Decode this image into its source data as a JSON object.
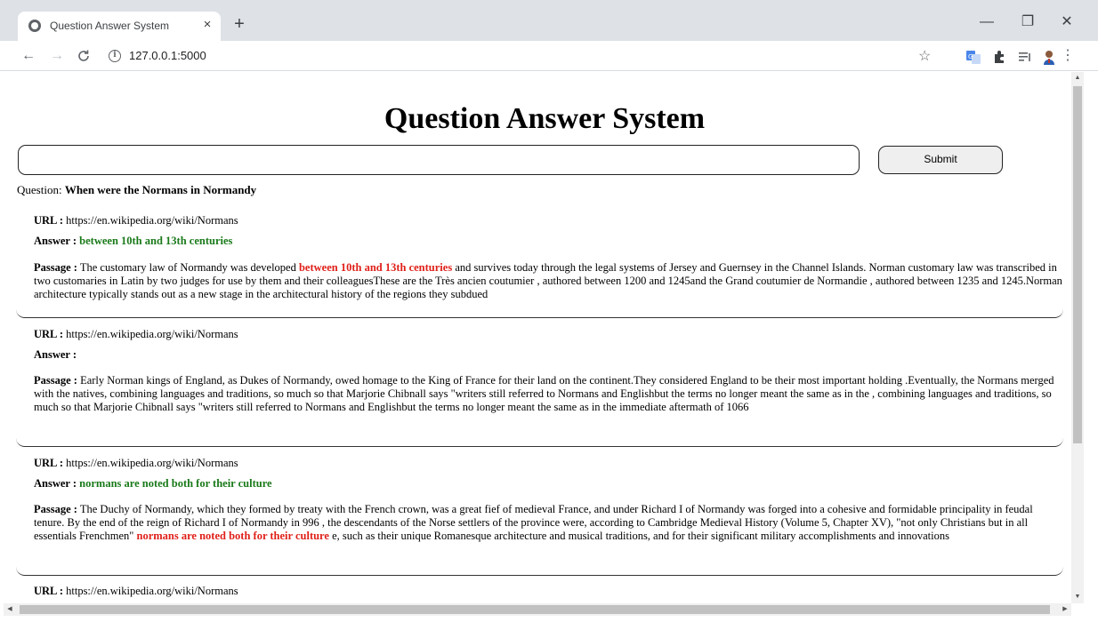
{
  "browser": {
    "tab_title": "Question Answer System",
    "tab_close": "×",
    "new_tab": "+",
    "url": "127.0.0.1:5000",
    "minimize": "—",
    "restore": "❐",
    "close": "✕"
  },
  "page": {
    "title": "Question Answer System",
    "search_input_value": "",
    "submit_label": "Submit",
    "question_label": "Question:",
    "question_text": "When were the Normans in Normandy"
  },
  "labels": {
    "url": "URL :",
    "answer": "Answer :",
    "passage": "Passage :"
  },
  "results": [
    {
      "url": "https://en.wikipedia.org/wiki/Normans",
      "answer": "between 10th and 13th centuries",
      "passage_before": "The customary law of Normandy was developed",
      "passage_highlight": "between 10th and 13th centuries",
      "passage_after": "and survives today through the legal systems of Jersey and Guernsey in the Channel Islands. Norman customary law was transcribed in two customaries in Latin by two judges for use by them and their colleaguesThese are the Très ancien coutumier , authored between 1200 and 1245and the Grand coutumier de Normandie , authored between 1235 and 1245.Norman architecture typically stands out as a new stage in the architectural history of the regions they subdued"
    },
    {
      "url": "https://en.wikipedia.org/wiki/Normans",
      "answer": "",
      "passage_before": "Early Norman kings of England, as Dukes of Normandy, owed homage to the King of France for their land on the continent.They considered England to be their most important holding .Eventually, the Normans merged with the natives, combining languages and traditions, so much so that Marjorie Chibnall says \"writers still referred to Normans and Englishbut the terms no longer meant the same as in the , combining languages and traditions, so much so that Marjorie Chibnall says \"writers still referred to Normans and Englishbut the terms no longer meant the same as in the immediate aftermath of 1066",
      "passage_highlight": "",
      "passage_after": ""
    },
    {
      "url": "https://en.wikipedia.org/wiki/Normans",
      "answer": "normans are noted both for their culture",
      "passage_before": "The Duchy of Normandy, which they formed by treaty with the French crown, was a great fief of medieval France, and under Richard I of Normandy was forged into a cohesive and formidable principality in feudal tenure. By the end of the reign of Richard I of Normandy in 996 , the descendants of the Norse settlers of the province were, according to Cambridge Medieval History (Volume 5, Chapter XV), \"not only Christians but in all essentials Frenchmen\"",
      "passage_highlight": "normans are noted both for their culture",
      "passage_after": "e, such as their unique Romanesque architecture and musical traditions, and for their significant military accomplishments and innovations"
    },
    {
      "url": "https://en.wikipedia.org/wiki/Normans"
    }
  ],
  "colors": {
    "answer_green": "#1a7a1a",
    "highlight_red": "#e0201a",
    "tabstrip": "#dee1e6"
  }
}
